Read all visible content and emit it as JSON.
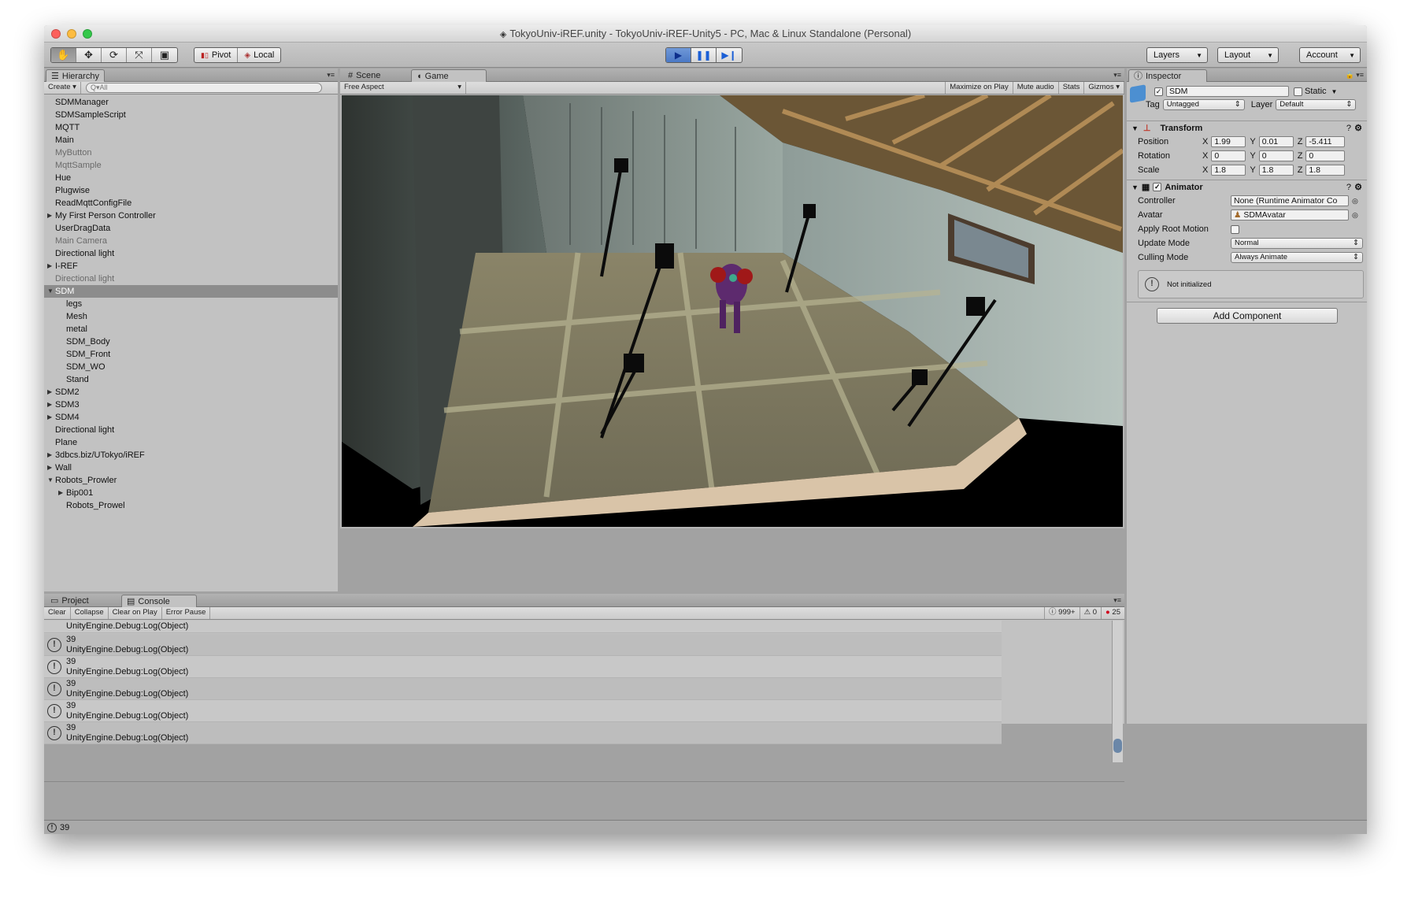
{
  "window": {
    "title": "TokyoUniv-iREF.unity - TokyoUniv-iREF-Unity5 - PC, Mac & Linux Standalone (Personal)"
  },
  "toolbar": {
    "transform_tools": [
      "hand-tool-icon",
      "move-tool-icon",
      "rotate-tool-icon",
      "scale-tool-icon",
      "rect-tool-icon"
    ],
    "pivot_label": "Pivot",
    "local_label": "Local",
    "layers_label": "Layers",
    "layout_label": "Layout",
    "account_label": "Account"
  },
  "hierarchy": {
    "tab_label": "Hierarchy",
    "create_label": "Create",
    "search_placeholder": "Q▾All",
    "items": [
      {
        "label": "SDMManager",
        "depth": 0,
        "expander": "",
        "dim": false
      },
      {
        "label": "SDMSampleScript",
        "depth": 0,
        "expander": "",
        "dim": false
      },
      {
        "label": "MQTT",
        "depth": 0,
        "expander": "",
        "dim": false
      },
      {
        "label": "Main",
        "depth": 0,
        "expander": "",
        "dim": false
      },
      {
        "label": "MyButton",
        "depth": 0,
        "expander": "",
        "dim": true
      },
      {
        "label": "MqttSample",
        "depth": 0,
        "expander": "",
        "dim": true
      },
      {
        "label": "Hue",
        "depth": 0,
        "expander": "",
        "dim": false
      },
      {
        "label": "Plugwise",
        "depth": 0,
        "expander": "",
        "dim": false
      },
      {
        "label": "ReadMqttConfigFile",
        "depth": 0,
        "expander": "",
        "dim": false
      },
      {
        "label": "My First Person Controller",
        "depth": 0,
        "expander": "collapsed",
        "dim": false
      },
      {
        "label": "UserDragData",
        "depth": 0,
        "expander": "",
        "dim": false
      },
      {
        "label": "Main Camera",
        "depth": 0,
        "expander": "",
        "dim": true
      },
      {
        "label": "Directional light",
        "depth": 0,
        "expander": "",
        "dim": false
      },
      {
        "label": "I-REF",
        "depth": 0,
        "expander": "collapsed",
        "dim": false
      },
      {
        "label": "Directional light",
        "depth": 0,
        "expander": "",
        "dim": true
      },
      {
        "label": "SDM",
        "depth": 0,
        "expander": "expanded",
        "dim": false,
        "selected": true
      },
      {
        "label": "legs",
        "depth": 1,
        "expander": "",
        "dim": false
      },
      {
        "label": "Mesh",
        "depth": 1,
        "expander": "",
        "dim": false
      },
      {
        "label": "metal",
        "depth": 1,
        "expander": "",
        "dim": false
      },
      {
        "label": "SDM_Body",
        "depth": 1,
        "expander": "",
        "dim": false
      },
      {
        "label": "SDM_Front",
        "depth": 1,
        "expander": "",
        "dim": false
      },
      {
        "label": "SDM_WO",
        "depth": 1,
        "expander": "",
        "dim": false
      },
      {
        "label": "Stand",
        "depth": 1,
        "expander": "",
        "dim": false
      },
      {
        "label": "SDM2",
        "depth": 0,
        "expander": "collapsed",
        "dim": false
      },
      {
        "label": "SDM3",
        "depth": 0,
        "expander": "collapsed",
        "dim": false
      },
      {
        "label": "SDM4",
        "depth": 0,
        "expander": "collapsed",
        "dim": false
      },
      {
        "label": "Directional light",
        "depth": 0,
        "expander": "",
        "dim": false
      },
      {
        "label": "Plane",
        "depth": 0,
        "expander": "",
        "dim": false
      },
      {
        "label": "3dbcs.biz/UTokyo/iREF",
        "depth": 0,
        "expander": "collapsed",
        "dim": false
      },
      {
        "label": "Wall",
        "depth": 0,
        "expander": "collapsed",
        "dim": false
      },
      {
        "label": "Robots_Prowler",
        "depth": 0,
        "expander": "expanded",
        "dim": false
      },
      {
        "label": "Bip001",
        "depth": 1,
        "expander": "collapsed",
        "dim": false
      },
      {
        "label": "Robots_Prowel",
        "depth": 1,
        "expander": "",
        "dim": false
      }
    ]
  },
  "center": {
    "scene_tab": "Scene",
    "game_tab": "Game",
    "aspect": "Free Aspect",
    "maximize_on_play": "Maximize on Play",
    "mute_audio": "Mute audio",
    "stats": "Stats",
    "gizmos": "Gizmos"
  },
  "inspector": {
    "tab_label": "Inspector",
    "object_name": "SDM",
    "static_label": "Static",
    "tag_label": "Tag",
    "tag_value": "Untagged",
    "layer_label": "Layer",
    "layer_value": "Default",
    "transform": {
      "title": "Transform",
      "position_label": "Position",
      "position": [
        "1.99",
        "0.01",
        "-5.411"
      ],
      "rotation_label": "Rotation",
      "rotation": [
        "0",
        "0",
        "0"
      ],
      "scale_label": "Scale",
      "scale": [
        "1.8",
        "1.8",
        "1.8"
      ],
      "axis_x": "X",
      "axis_y": "Y",
      "axis_z": "Z"
    },
    "animator": {
      "title": "Animator",
      "controller_label": "Controller",
      "controller_value": "None (Runtime Animator Co",
      "avatar_label": "Avatar",
      "avatar_value": "SDMAvatar",
      "apply_root_motion_label": "Apply Root Motion",
      "update_mode_label": "Update Mode",
      "update_mode_value": "Normal",
      "culling_mode_label": "Culling Mode",
      "culling_mode_value": "Always Animate",
      "status": "Not initialized"
    },
    "add_component": "Add Component"
  },
  "bottom": {
    "project_tab": "Project",
    "console_tab": "Console",
    "clear": "Clear",
    "collapse": "Collapse",
    "clear_on_play": "Clear on Play",
    "error_pause": "Error Pause",
    "log_count": "999+",
    "warn_count": "0",
    "error_count": "25",
    "partial_first_line": "UnityEngine.Debug:Log(Object)",
    "entries": [
      {
        "value": "39",
        "source": "UnityEngine.Debug:Log(Object)"
      },
      {
        "value": "39",
        "source": "UnityEngine.Debug:Log(Object)"
      },
      {
        "value": "39",
        "source": "UnityEngine.Debug:Log(Object)"
      },
      {
        "value": "39",
        "source": "UnityEngine.Debug:Log(Object)"
      },
      {
        "value": "39",
        "source": "UnityEngine.Debug:Log(Object)"
      }
    ]
  },
  "status_bar": {
    "message": "39"
  },
  "colors": {
    "window_bg": "#a2a2a2",
    "panel_bg": "#c2c2c2",
    "selection": "#8c8c8c",
    "play_active": "#4b79c6",
    "error_red": "#d0021b"
  }
}
